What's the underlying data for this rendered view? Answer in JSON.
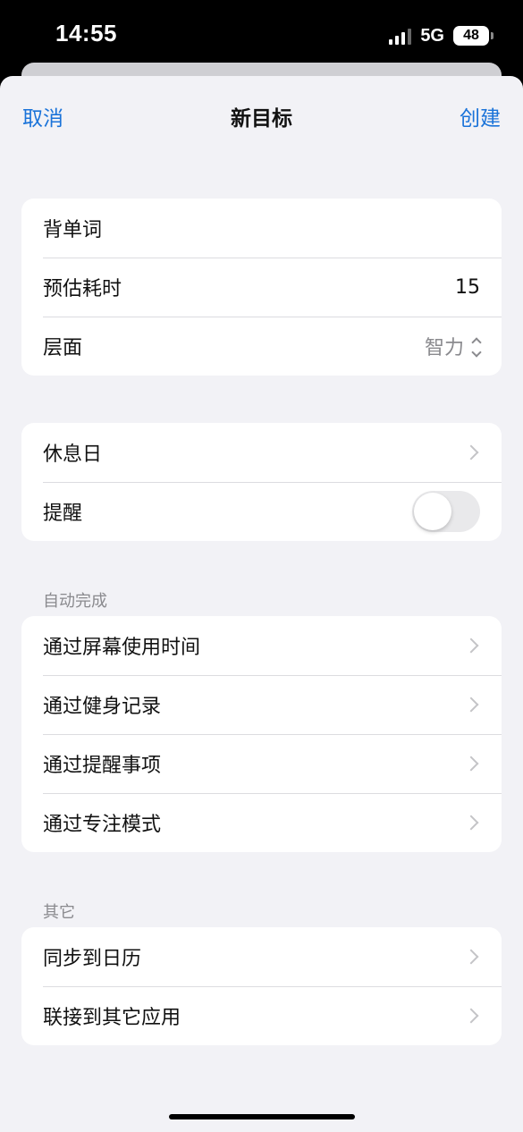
{
  "status": {
    "time": "14:55",
    "network": "5G",
    "battery": "48"
  },
  "nav": {
    "cancel": "取消",
    "title": "新目标",
    "create": "创建"
  },
  "form": {
    "name_value": "背单词",
    "duration_label": "预估耗时",
    "duration_value": "15",
    "level_label": "层面",
    "level_value": "智力"
  },
  "schedule": {
    "rest_day_label": "休息日",
    "reminder_label": "提醒",
    "reminder_on": false
  },
  "auto_complete": {
    "header": "自动完成",
    "items": [
      {
        "label": "通过屏幕使用时间"
      },
      {
        "label": "通过健身记录"
      },
      {
        "label": "通过提醒事项"
      },
      {
        "label": "通过专注模式"
      }
    ]
  },
  "other": {
    "header": "其它",
    "items": [
      {
        "label": "同步到日历"
      },
      {
        "label": "联接到其它应用"
      }
    ]
  },
  "colors": {
    "accent": "#1a73d9",
    "background": "#f2f2f6",
    "secondary_text": "#8a8a8e"
  }
}
